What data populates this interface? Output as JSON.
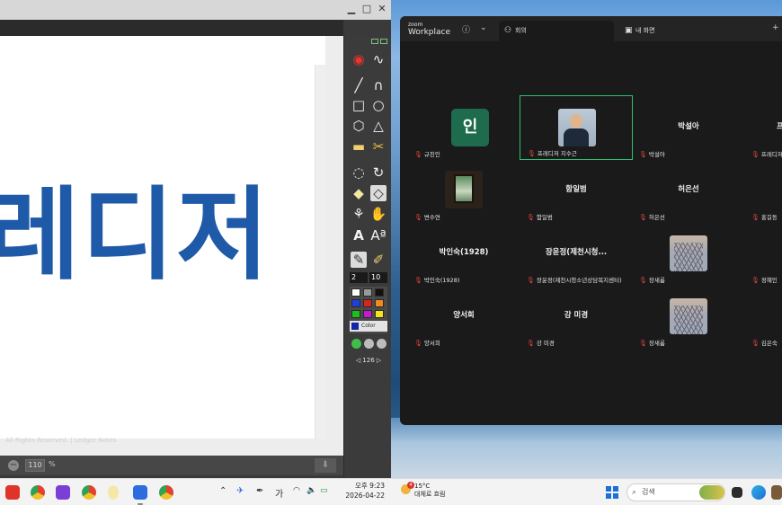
{
  "left_app": {
    "canvas_text": "레디저",
    "footer_text": "All Rights Reserved. | Ledger Notes",
    "zoom_value": "110",
    "zoom_unit": "%",
    "pen_size": "2",
    "font_size": "10",
    "color_dropdown_label": "Color",
    "page_number": "126",
    "palette": [
      "#ffffff",
      "#9a9a9a",
      "#111111",
      "#1d3fe0",
      "#d9241d",
      "#f28a1e",
      "#19c11b",
      "#c41bd0",
      "#f4e41c"
    ]
  },
  "zoom": {
    "brand_small": "zoom",
    "brand_large": "Workplace",
    "tabs": [
      {
        "label": "회의",
        "icon": "people-icon",
        "active": true
      },
      {
        "label": "내 화면",
        "icon": "camera-icon",
        "active": false
      }
    ],
    "participants": [
      {
        "tag": "규친인",
        "center": "",
        "avatar_letter": "인",
        "kind": "avatar"
      },
      {
        "tag": "프레디저 지수근",
        "center": "",
        "kind": "photo-person",
        "speaking": true
      },
      {
        "tag": "박설아",
        "center": "박설아",
        "kind": "name"
      },
      {
        "tag": "프레디저 직원",
        "center": "프",
        "kind": "name"
      },
      {
        "tag": "변수연",
        "center": "",
        "kind": "photo-window"
      },
      {
        "tag": "함일범",
        "center": "함일범",
        "kind": "name"
      },
      {
        "tag": "허은선",
        "center": "허은선",
        "kind": "name"
      },
      {
        "tag": "홍길동",
        "center": "",
        "kind": "name"
      },
      {
        "tag": "박인숙(1928)",
        "center": "박인숙(1928)",
        "kind": "name"
      },
      {
        "tag": "장윤정(제천시청소년상담복지센터)",
        "center": "장윤정(제천시청...",
        "kind": "name"
      },
      {
        "tag": "장새롬",
        "center": "",
        "kind": "photo-tree"
      },
      {
        "tag": "정혜인",
        "center": "",
        "kind": "name"
      },
      {
        "tag": "양서희",
        "center": "양서희",
        "kind": "name"
      },
      {
        "tag": "강 미경",
        "center": "강 미경",
        "kind": "name"
      },
      {
        "tag": "장새롬",
        "center": "",
        "kind": "photo-tree"
      },
      {
        "tag": "김은숙",
        "center": "",
        "kind": "name"
      }
    ]
  },
  "taskbar": {
    "time": "오후 9:23",
    "date": "2026-04-22",
    "ime_label": "가",
    "weather_temp": "15°C",
    "weather_desc": "대체로 흐림",
    "weather_badge": "4",
    "search_placeholder": "검색"
  }
}
